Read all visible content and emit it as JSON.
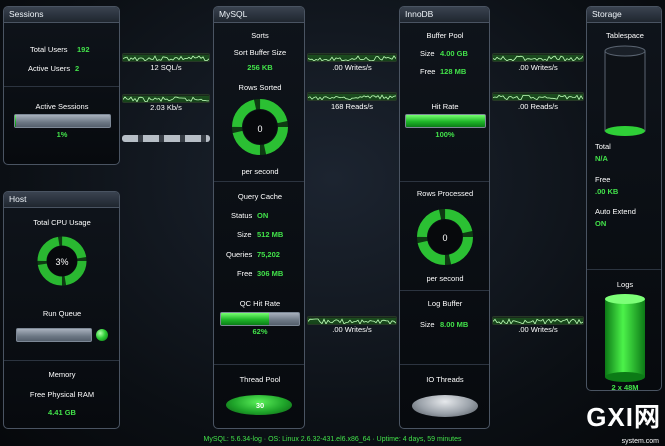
{
  "sessions": {
    "title": "Sessions",
    "total_users_label": "Total Users",
    "total_users_value": "192",
    "active_users_label": "Active Users",
    "active_users_value": "2",
    "active_sessions_label": "Active Sessions",
    "active_sessions_value": "1%",
    "active_sessions_fraction": 0.01
  },
  "host": {
    "title": "Host",
    "cpu_label": "Total CPU Usage",
    "cpu_value": "3%",
    "run_queue_label": "Run Queue",
    "memory_label": "Memory",
    "free_ram_label": "Free Physical RAM",
    "free_ram_value": "4.41 GB"
  },
  "links": {
    "sessions_mysql_1": "12 SQL/s",
    "sessions_mysql_2": "2.03 Kb/s",
    "mysql_innodb_1": ".00 Writes/s",
    "mysql_innodb_2": "168 Reads/s",
    "mysql_innodb_3": ".00 Writes/s",
    "innodb_storage_1": ".00 Writes/s",
    "innodb_storage_2": ".00 Reads/s",
    "innodb_storage_3": ".00 Writes/s"
  },
  "mysql": {
    "title": "MySQL",
    "sorts_label": "Sorts",
    "sort_buffer_label": "Sort Buffer Size",
    "sort_buffer_value": "256 KB",
    "rows_sorted_label": "Rows Sorted",
    "rows_sorted_value": "0",
    "per_second_label": "per second",
    "query_cache_label": "Query Cache",
    "status_label": "Status",
    "status_value": "ON",
    "size_label": "Size",
    "size_value": "512 MB",
    "queries_label": "Queries",
    "queries_value": "75,202",
    "free_label": "Free",
    "free_value": "306 MB",
    "qc_hit_rate_label": "QC Hit Rate",
    "qc_hit_rate_value": "62%",
    "qc_hit_rate_fraction": 0.62,
    "thread_pool_label": "Thread Pool",
    "thread_pool_value": "30"
  },
  "innodb": {
    "title": "InnoDB",
    "buffer_pool_label": "Buffer Pool",
    "size_label": "Size",
    "size_value": "4.00 GB",
    "free_label": "Free",
    "free_value": "128 MB",
    "hit_rate_label": "Hit Rate",
    "hit_rate_value": "100%",
    "hit_rate_fraction": 1.0,
    "rows_processed_label": "Rows Processed",
    "rows_processed_value": "0",
    "per_second_label": "per second",
    "log_buffer_label": "Log Buffer",
    "log_size_label": "Size",
    "log_size_value": "8.00 MB",
    "io_threads_label": "IO Threads"
  },
  "storage": {
    "title": "Storage",
    "tablespace_label": "Tablespace",
    "total_label": "Total",
    "total_value": "N/A",
    "free_label": "Free",
    "free_value": ".00 KB",
    "auto_extend_label": "Auto Extend",
    "auto_extend_value": "ON",
    "logs_label": "Logs",
    "logs_value": "2 x 48M"
  },
  "status_bar": "MySQL: 5.6.34-log  ·  OS: Linux 2.6.32-431.el6.x86_64  ·  Uptime: 4 days, 59 minutes",
  "watermark": {
    "brand": "GXI网",
    "site": "system.com"
  },
  "colors": {
    "accent_green": "#42e24a",
    "panel_border": "#4a5462",
    "background": "#0b0f14"
  }
}
